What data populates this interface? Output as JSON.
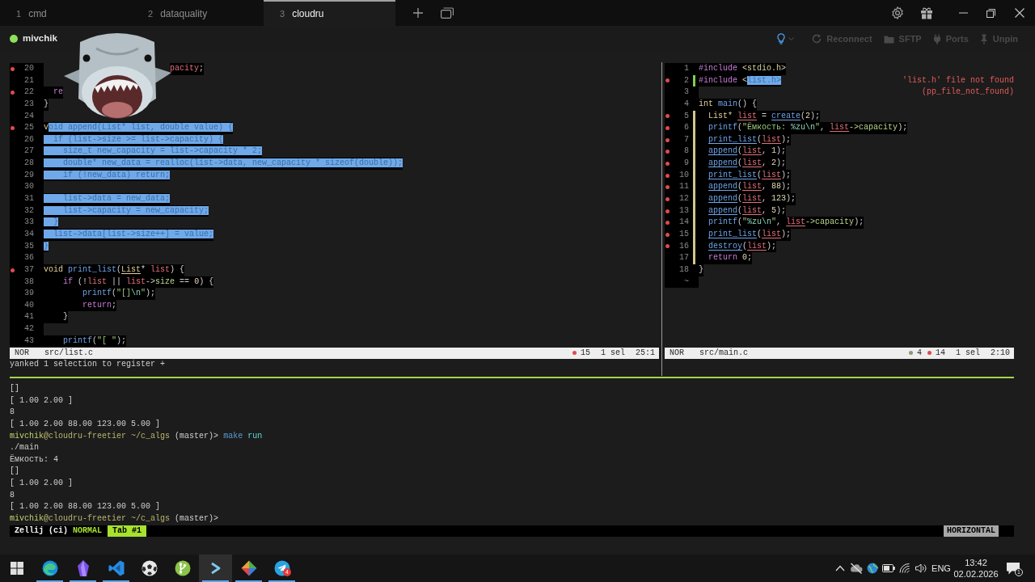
{
  "title_bar": {
    "tabs": [
      {
        "number": "1",
        "label": "cmd",
        "selected": false
      },
      {
        "number": "2",
        "label": "dataquality",
        "selected": false
      },
      {
        "number": "3",
        "label": "cloudru",
        "selected": true
      }
    ]
  },
  "session_bar": {
    "online": true,
    "host": "mivchik",
    "actions": [
      {
        "kind": "hints",
        "disabled": false
      },
      {
        "kind": "reconnect",
        "label": "Reconnect",
        "disabled": true
      },
      {
        "kind": "sftp",
        "label": "SFTP",
        "disabled": true
      },
      {
        "kind": "ports",
        "label": "Ports",
        "disabled": true
      },
      {
        "kind": "unpin",
        "label": "Unpin",
        "disabled": true
      }
    ]
  },
  "overlay": {
    "kind": "shark"
  },
  "panes": [
    {
      "lines": [
        {
          "number": "20",
          "diag": true,
          "kind": "clipped",
          "tokens": [
            {
              "kind": "var",
              "text": "                          pacity"
            },
            {
              "kind": "pl",
              "text": ";"
            }
          ]
        },
        {
          "number": "21",
          "diag": false,
          "kind": "plain"
        },
        {
          "number": "22",
          "diag": true,
          "kind": "plain",
          "tokens": [
            {
              "kind": "kw",
              "text": "  re"
            }
          ]
        },
        {
          "number": "23",
          "diag": false,
          "kind": "plain",
          "tokens": [
            {
              "kind": "pl",
              "text": "}"
            }
          ]
        },
        {
          "number": "24",
          "diag": false,
          "kind": "plain"
        },
        {
          "number": "25",
          "diag": true,
          "kind": "plain",
          "tokens": [
            {
              "kind": "ty",
              "text": "v"
            },
            {
              "kind": "sel",
              "text": "oid append(List* list, double value) {"
            }
          ]
        },
        {
          "number": "26",
          "diag": false,
          "kind": "plain",
          "tokens": [
            {
              "kind": "sel",
              "text": "  if (list->size >= list->capacity) {"
            }
          ]
        },
        {
          "number": "27",
          "diag": false,
          "kind": "plain",
          "tokens": [
            {
              "kind": "sel",
              "text": "    size_t new_capacity = list->capacity * 2;"
            }
          ]
        },
        {
          "number": "28",
          "diag": false,
          "kind": "plain",
          "tokens": [
            {
              "kind": "sel",
              "text": "    double* new_data = realloc(list->data, new_capacity * sizeof(double));"
            }
          ]
        },
        {
          "number": "29",
          "diag": false,
          "kind": "plain",
          "tokens": [
            {
              "kind": "sel",
              "text": "    if (!new_data) return;"
            }
          ]
        },
        {
          "number": "30",
          "diag": false,
          "kind": "plain"
        },
        {
          "number": "31",
          "diag": false,
          "kind": "plain",
          "tokens": [
            {
              "kind": "sel",
              "text": "    list->data = new_data;"
            }
          ]
        },
        {
          "number": "32",
          "diag": false,
          "kind": "plain",
          "tokens": [
            {
              "kind": "sel",
              "text": "    list->capacity = new_capacity;"
            }
          ]
        },
        {
          "number": "33",
          "diag": false,
          "kind": "plain",
          "tokens": [
            {
              "kind": "sel",
              "text": "  }"
            }
          ]
        },
        {
          "number": "34",
          "diag": false,
          "kind": "plain",
          "tokens": [
            {
              "kind": "sel",
              "text": "  list->data[list->size++] = value;"
            }
          ]
        },
        {
          "number": "35",
          "diag": false,
          "kind": "plain",
          "tokens": [
            {
              "kind": "sel",
              "text": "}"
            }
          ]
        },
        {
          "number": "36",
          "diag": false,
          "kind": "plain"
        },
        {
          "number": "37",
          "diag": true,
          "kind": "plain",
          "tokens": [
            {
              "kind": "ty",
              "text": "void"
            },
            {
              "kind": "fn",
              "text": " print_list"
            },
            {
              "kind": "pl",
              "text": "("
            },
            {
              "kind": "tyu",
              "text": "List"
            },
            {
              "kind": "pl",
              "text": "* "
            },
            {
              "kind": "var",
              "text": "list"
            },
            {
              "kind": "pl",
              "text": ") {"
            }
          ]
        },
        {
          "number": "38",
          "diag": false,
          "kind": "plain",
          "tokens": [
            {
              "kind": "kw",
              "text": "    if"
            },
            {
              "kind": "pl",
              "text": " (!"
            },
            {
              "kind": "var",
              "text": "list"
            },
            {
              "kind": "pl",
              "text": " || "
            },
            {
              "kind": "var",
              "text": "list"
            },
            {
              "kind": "pl",
              "text": "->"
            },
            {
              "kind": "fld",
              "text": "size"
            },
            {
              "kind": "pl",
              "text": " == "
            },
            {
              "kind": "num",
              "text": "0"
            },
            {
              "kind": "pl",
              "text": ") {"
            }
          ]
        },
        {
          "number": "39",
          "diag": false,
          "kind": "plain",
          "tokens": [
            {
              "kind": "fn",
              "text": "        printf"
            },
            {
              "kind": "pl",
              "text": "("
            },
            {
              "kind": "str",
              "text": "\"[]"
            },
            {
              "kind": "esc",
              "text": "\\n"
            },
            {
              "kind": "str",
              "text": "\""
            },
            {
              "kind": "pl",
              "text": ");"
            }
          ]
        },
        {
          "number": "40",
          "diag": false,
          "kind": "plain",
          "tokens": [
            {
              "kind": "kw",
              "text": "        return"
            },
            {
              "kind": "pl",
              "text": ";"
            }
          ]
        },
        {
          "number": "41",
          "diag": false,
          "kind": "plain",
          "tokens": [
            {
              "kind": "pl",
              "text": "    }"
            }
          ]
        },
        {
          "number": "42",
          "diag": false,
          "kind": "plain"
        },
        {
          "number": "43",
          "diag": false,
          "kind": "plain",
          "tokens": [
            {
              "kind": "fn",
              "text": "    printf"
            },
            {
              "kind": "pl",
              "text": "("
            },
            {
              "kind": "str",
              "text": "\"[ \""
            },
            {
              "kind": "pl",
              "text": ");"
            }
          ]
        }
      ],
      "status": {
        "mode": "NOR",
        "file": "src/list.c",
        "diagnostics": [
          {
            "kind": "error",
            "count": "15"
          }
        ],
        "selections": "1 sel",
        "position": "25:1"
      },
      "message": "yanked 1 selection to register +"
    },
    {
      "lines": [
        {
          "number": "1",
          "diag": false,
          "kind": "plain",
          "tokens": [
            {
              "kind": "pre",
              "text": "#include"
            },
            {
              "kind": "hdr",
              "text": " <stdio.h>"
            }
          ]
        },
        {
          "number": "2",
          "diag": true,
          "kind": "added",
          "tokens": [
            {
              "kind": "pre",
              "text": "#include"
            },
            {
              "kind": "hdr",
              "text": " <"
            },
            {
              "kind": "sel",
              "text": "list.h>"
            }
          ],
          "note": "'list.h' file not found"
        },
        {
          "number": "3",
          "diag": false,
          "kind": "plain",
          "note": "(pp_file_not_found)"
        },
        {
          "number": "4",
          "diag": false,
          "kind": "plain",
          "tokens": [
            {
              "kind": "ty",
              "text": "int"
            },
            {
              "kind": "fn",
              "text": " main"
            },
            {
              "kind": "pl",
              "text": "() {"
            }
          ]
        },
        {
          "number": "5",
          "diag": true,
          "kind": "modified",
          "tokens": [
            {
              "kind": "ty",
              "text": "  List*"
            },
            {
              "kind": "varu",
              "text": " list"
            },
            {
              "kind": "pl",
              "text": " = "
            },
            {
              "kind": "fnu",
              "text": "create"
            },
            {
              "kind": "pl",
              "text": "("
            },
            {
              "kind": "num",
              "text": "2"
            },
            {
              "kind": "pl",
              "text": ");"
            }
          ]
        },
        {
          "number": "6",
          "diag": true,
          "kind": "modified",
          "tokens": [
            {
              "kind": "fn",
              "text": "  printf"
            },
            {
              "kind": "pl",
              "text": "("
            },
            {
              "kind": "str",
              "text": "\"Ёмкость: "
            },
            {
              "kind": "esc",
              "text": "%zu\\n"
            },
            {
              "kind": "str",
              "text": "\""
            },
            {
              "kind": "pl",
              "text": ", "
            },
            {
              "kind": "varu",
              "text": "list"
            },
            {
              "kind": "fld",
              "text": "->capacity"
            },
            {
              "kind": "pl",
              "text": ");"
            }
          ]
        },
        {
          "number": "7",
          "diag": true,
          "kind": "modified",
          "tokens": [
            {
              "kind": "fnu",
              "text": "  print_list"
            },
            {
              "kind": "pl",
              "text": "("
            },
            {
              "kind": "varu",
              "text": "list"
            },
            {
              "kind": "pl",
              "text": ");"
            }
          ]
        },
        {
          "number": "8",
          "diag": true,
          "kind": "modified",
          "tokens": [
            {
              "kind": "fnu",
              "text": "  append"
            },
            {
              "kind": "pl",
              "text": "("
            },
            {
              "kind": "varu",
              "text": "list"
            },
            {
              "kind": "pl",
              "text": ", "
            },
            {
              "kind": "num",
              "text": "1"
            },
            {
              "kind": "pl",
              "text": ");"
            }
          ]
        },
        {
          "number": "9",
          "diag": true,
          "kind": "modified",
          "tokens": [
            {
              "kind": "fnu",
              "text": "  append"
            },
            {
              "kind": "pl",
              "text": "("
            },
            {
              "kind": "varu",
              "text": "list"
            },
            {
              "kind": "pl",
              "text": ", "
            },
            {
              "kind": "num",
              "text": "2"
            },
            {
              "kind": "pl",
              "text": ");"
            }
          ]
        },
        {
          "number": "10",
          "diag": true,
          "kind": "modified",
          "tokens": [
            {
              "kind": "fnu",
              "text": "  print_list"
            },
            {
              "kind": "pl",
              "text": "("
            },
            {
              "kind": "varu",
              "text": "list"
            },
            {
              "kind": "pl",
              "text": ");"
            }
          ]
        },
        {
          "number": "11",
          "diag": true,
          "kind": "modified",
          "tokens": [
            {
              "kind": "fnu",
              "text": "  append"
            },
            {
              "kind": "pl",
              "text": "("
            },
            {
              "kind": "varu",
              "text": "list"
            },
            {
              "kind": "pl",
              "text": ", "
            },
            {
              "kind": "num",
              "text": "88"
            },
            {
              "kind": "pl",
              "text": ");"
            }
          ]
        },
        {
          "number": "12",
          "diag": true,
          "kind": "modified",
          "tokens": [
            {
              "kind": "fnu",
              "text": "  append"
            },
            {
              "kind": "pl",
              "text": "("
            },
            {
              "kind": "varu",
              "text": "list"
            },
            {
              "kind": "pl",
              "text": ", "
            },
            {
              "kind": "num",
              "text": "123"
            },
            {
              "kind": "pl",
              "text": ");"
            }
          ]
        },
        {
          "number": "13",
          "diag": true,
          "kind": "modified",
          "tokens": [
            {
              "kind": "fnu",
              "text": "  append"
            },
            {
              "kind": "pl",
              "text": "("
            },
            {
              "kind": "varu",
              "text": "list"
            },
            {
              "kind": "pl",
              "text": ", "
            },
            {
              "kind": "num",
              "text": "5"
            },
            {
              "kind": "pl",
              "text": ");"
            }
          ]
        },
        {
          "number": "14",
          "diag": true,
          "kind": "modified",
          "tokens": [
            {
              "kind": "fn",
              "text": "  printf"
            },
            {
              "kind": "pl",
              "text": "("
            },
            {
              "kind": "str",
              "text": "\""
            },
            {
              "kind": "esc",
              "text": "%zu\\n"
            },
            {
              "kind": "str",
              "text": "\""
            },
            {
              "kind": "pl",
              "text": ", "
            },
            {
              "kind": "varu",
              "text": "list"
            },
            {
              "kind": "fld",
              "text": "->capacity"
            },
            {
              "kind": "pl",
              "text": ");"
            }
          ]
        },
        {
          "number": "15",
          "diag": true,
          "kind": "modified",
          "tokens": [
            {
              "kind": "fnu",
              "text": "  print_list"
            },
            {
              "kind": "pl",
              "text": "("
            },
            {
              "kind": "varu",
              "text": "list"
            },
            {
              "kind": "pl",
              "text": ");"
            }
          ]
        },
        {
          "number": "16",
          "diag": true,
          "kind": "modified",
          "tokens": [
            {
              "kind": "fnu",
              "text": "  destroy"
            },
            {
              "kind": "pl",
              "text": "("
            },
            {
              "kind": "varu",
              "text": "list"
            },
            {
              "kind": "pl",
              "text": ");"
            }
          ]
        },
        {
          "number": "17",
          "diag": false,
          "kind": "modified",
          "tokens": [
            {
              "kind": "kw",
              "text": "  return"
            },
            {
              "kind": "num",
              "text": " 0"
            },
            {
              "kind": "pl",
              "text": ";"
            }
          ]
        },
        {
          "number": "18",
          "diag": false,
          "kind": "plain",
          "tokens": [
            {
              "kind": "pl",
              "text": "}"
            }
          ]
        },
        {
          "number": "~",
          "diag": false,
          "kind": "plain"
        }
      ],
      "status": {
        "mode": "NOR",
        "file": "src/main.c",
        "diagnostics": [
          {
            "kind": "warning",
            "count": "4"
          },
          {
            "kind": "error",
            "count": "14"
          }
        ],
        "selections": "1 sel",
        "position": "2:10"
      }
    }
  ],
  "terminal": {
    "lines": [
      {
        "kind": "output",
        "text": "[]"
      },
      {
        "kind": "output",
        "text": "[ 1.00 2.00 ]"
      },
      {
        "kind": "output",
        "text": "8"
      },
      {
        "kind": "output",
        "text": "[ 1.00 2.00 88.00 123.00 5.00 ]"
      },
      {
        "kind": "prompt",
        "user": "mivchik",
        "host": "@cloudru-freetier",
        "cwd": "~/c_algs",
        "branch": "(master)>",
        "command": "make",
        "argument": "run"
      },
      {
        "kind": "output",
        "text": "./main"
      },
      {
        "kind": "output",
        "text": "Ёмкость: 4"
      },
      {
        "kind": "output",
        "text": "[]"
      },
      {
        "kind": "output",
        "text": "[ 1.00 2.00 ]"
      },
      {
        "kind": "output",
        "text": "8"
      },
      {
        "kind": "output",
        "text": "[ 1.00 2.00 88.00 123.00 5.00 ]"
      },
      {
        "kind": "prompt",
        "user": "mivchik",
        "host": "@cloudru-freetier",
        "cwd": "~/c_algs",
        "branch": "(master)>"
      }
    ]
  },
  "zellij_bar": {
    "session": "Zellij (ci)",
    "mode": "NORMAL",
    "tabs": [
      {
        "label": "Tab #1",
        "selected": true
      }
    ],
    "layout": "HORIZONTAL"
  },
  "taskbar": {
    "apps": [
      {
        "kind": "swirl",
        "running": true,
        "selected": false
      },
      {
        "kind": "gem",
        "running": true,
        "selected": false
      },
      {
        "kind": "ribbon",
        "running": true,
        "selected": false
      },
      {
        "kind": "ball",
        "running": false,
        "selected": false
      },
      {
        "kind": "branch",
        "running": false,
        "selected": false
      },
      {
        "kind": "terminal",
        "running": true,
        "selected": true
      },
      {
        "kind": "diamond",
        "running": true,
        "selected": false
      },
      {
        "kind": "plane",
        "running": true,
        "selected": false,
        "badge": "4"
      }
    ],
    "language": "ENG",
    "time": "13:42",
    "date": "02.02.2026",
    "notifications": "1"
  }
}
